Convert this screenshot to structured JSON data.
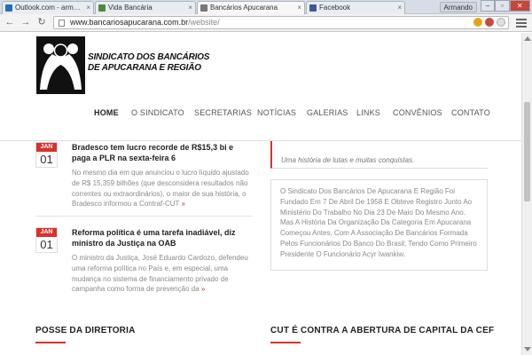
{
  "browser": {
    "tabs": [
      {
        "label": "Outlook.com - armando.",
        "icon_color": "#1e6fc1",
        "active": false
      },
      {
        "label": "Vida Bancária",
        "icon_color": "#4f8a3c",
        "active": false
      },
      {
        "label": "Bancários Apucarana",
        "icon_color": "#777777",
        "active": true
      },
      {
        "label": "Facebook",
        "icon_color": "#3b5998",
        "active": false
      }
    ],
    "tab_close_glyph": "×",
    "user_label": "Armando",
    "window_controls": [
      "–",
      "▫",
      "✕"
    ],
    "url_host": "www.bancariosapucarana.com.br",
    "url_path": "/website/"
  },
  "site": {
    "logo_line1": "SINDICATO DOS BANCÁRIOS",
    "logo_line2": "DE APUCARANA E REGIÃO",
    "nav": [
      "HOME",
      "O SINDICATO",
      "SECRETARIAS",
      "NOTÍCIAS",
      "GALERIAS",
      "LINKS",
      "CONVÊNIOS",
      "CONTATO"
    ],
    "active_nav": "HOME"
  },
  "news": [
    {
      "month": "JAN",
      "day": "01",
      "title": "Bradesco tem lucro recorde de R$15,3 bi e paga a PLR na sexta-feira 6",
      "excerpt": "No mesmo dia em que anunciou o lucro líquido ajustado de R$ 15,359 bilhões (que desconsidera resultados não correntes ou extraordinários), o maior de sua história, o Bradesco informou a Contraf-CUT",
      "more": "»"
    },
    {
      "month": "JAN",
      "day": "01",
      "title": "Reforma política é uma tarefa inadiável, diz ministro da Justiça na OAB",
      "excerpt": "O ministro da Justiça, José Eduardo Cardozo, defendeu uma reforma política no País e, em especial, uma mudança no sistema de financiamento privado de campanha como forma de prevenção da",
      "more": "»"
    }
  ],
  "sidebar": {
    "quote": "Uma história de lutas e muitas conquistas.",
    "history": "O Sindicato Dos Bancários De Apucarana E Região Foi Fundado Em 7 De Abril De 1958 E Obteve Registro Junto Ao Ministério Do Trabalho No Dia 23 De Maio Do Mesmo Ano. Mas A História Da Organização Da Categoria Em Apucarana Começou Antes, Com A Associação De Bancários Formada Pelos Funcionários Do Banco Do Brasil, Tendo Como Primeiro Presidente O Funcionário Acyr Iwankiw."
  },
  "sections": {
    "left": "POSSE DA DIRETORIA",
    "right": "CUT É CONTRA A ABERTURA DE CAPITAL DA CEF"
  },
  "colors": {
    "accent": "#d9312b"
  }
}
